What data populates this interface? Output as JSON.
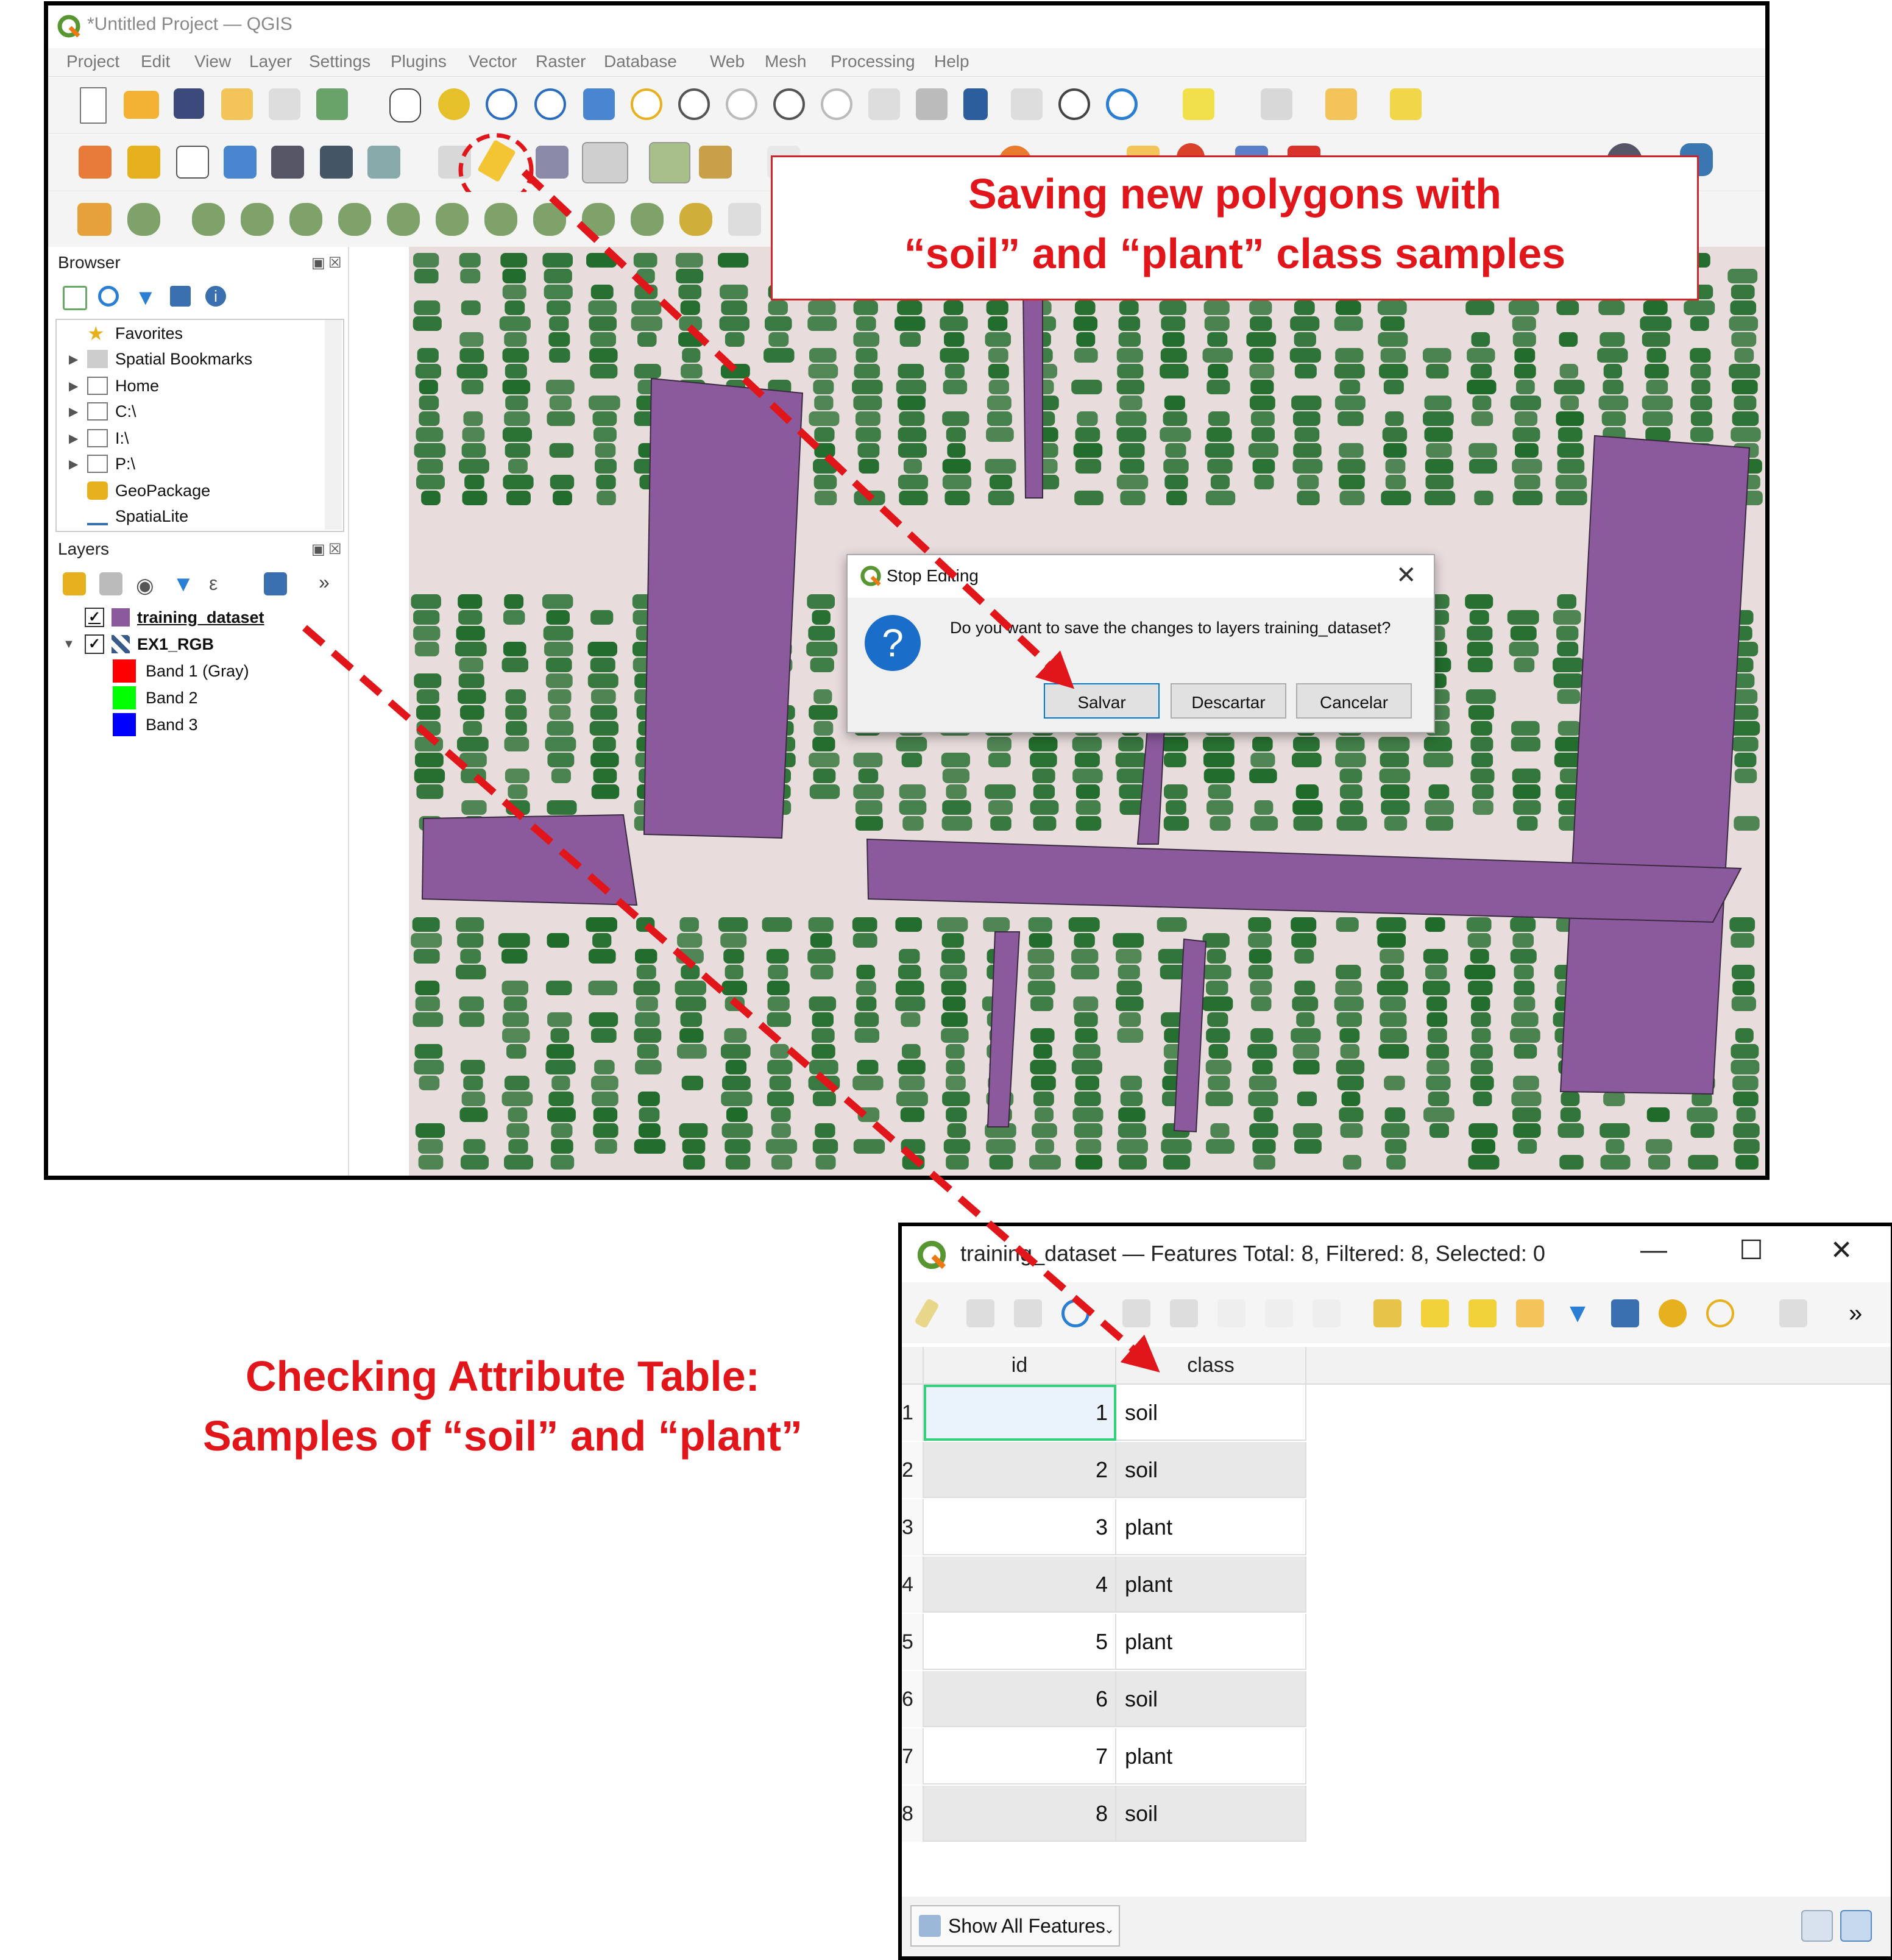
{
  "window": {
    "title": "*Untitled Project — QGIS",
    "menu": [
      "Project",
      "Edit",
      "View",
      "Layer",
      "Settings",
      "Plugins",
      "Vector",
      "Raster",
      "Database",
      "Web",
      "Mesh",
      "Processing",
      "Help"
    ]
  },
  "browser": {
    "title": "Browser",
    "items": [
      {
        "label": "Favorites",
        "icon": "star-icon"
      },
      {
        "label": "Spatial Bookmarks",
        "icon": "bookmark-icon"
      },
      {
        "label": "Home",
        "icon": "home-folder-icon"
      },
      {
        "label": "C:\\",
        "icon": "folder-icon"
      },
      {
        "label": "I:\\",
        "icon": "folder-icon"
      },
      {
        "label": "P:\\",
        "icon": "folder-icon"
      },
      {
        "label": "GeoPackage",
        "icon": "geopackage-icon"
      },
      {
        "label": "SpatiaLite",
        "icon": "spatialite-icon"
      }
    ]
  },
  "layers": {
    "title": "Layers",
    "items": [
      {
        "label": "training_dataset",
        "checked": "✓"
      },
      {
        "label": "EX1_RGB",
        "checked": "✓"
      },
      {
        "label": "Band 1 (Gray)",
        "color": "#ff0000"
      },
      {
        "label": "Band 2",
        "color": "#00ff00"
      },
      {
        "label": "Band 3",
        "color": "#0000ff"
      }
    ]
  },
  "dialog": {
    "title": "Stop Editing",
    "message": "Do you want to save the changes to layers training_dataset?",
    "icon": "?",
    "buttons": {
      "save": "Salvar",
      "discard": "Descartar",
      "cancel": "Cancelar"
    }
  },
  "annotations": {
    "top_line1": "Saving new polygons with",
    "top_line2": "“soil” and “plant” class samples",
    "bottom_line1": "Checking Attribute Table:",
    "bottom_line2": "Samples of “soil” and “plant”"
  },
  "attribute_table": {
    "title": "training_dataset — Features Total: 8, Filtered: 8, Selected: 0",
    "columns": [
      "id",
      "class"
    ],
    "rows": [
      {
        "n": "1",
        "id": "1",
        "class": "soil"
      },
      {
        "n": "2",
        "id": "2",
        "class": "soil"
      },
      {
        "n": "3",
        "id": "3",
        "class": "plant"
      },
      {
        "n": "4",
        "id": "4",
        "class": "plant"
      },
      {
        "n": "5",
        "id": "5",
        "class": "plant"
      },
      {
        "n": "6",
        "id": "6",
        "class": "soil"
      },
      {
        "n": "7",
        "id": "7",
        "class": "plant"
      },
      {
        "n": "8",
        "id": "8",
        "class": "soil"
      }
    ],
    "show_all": "Show All Features",
    "window_buttons": {
      "minimize": "—",
      "maximize": "☐",
      "close": "✕"
    }
  },
  "colors": {
    "annotation_red": "#e0161b",
    "polygon_fill": "#8a5a9c",
    "plant_green": "#1f6b2a",
    "soil_bg": "#e9dcdc",
    "qgis_green": "#589632"
  }
}
